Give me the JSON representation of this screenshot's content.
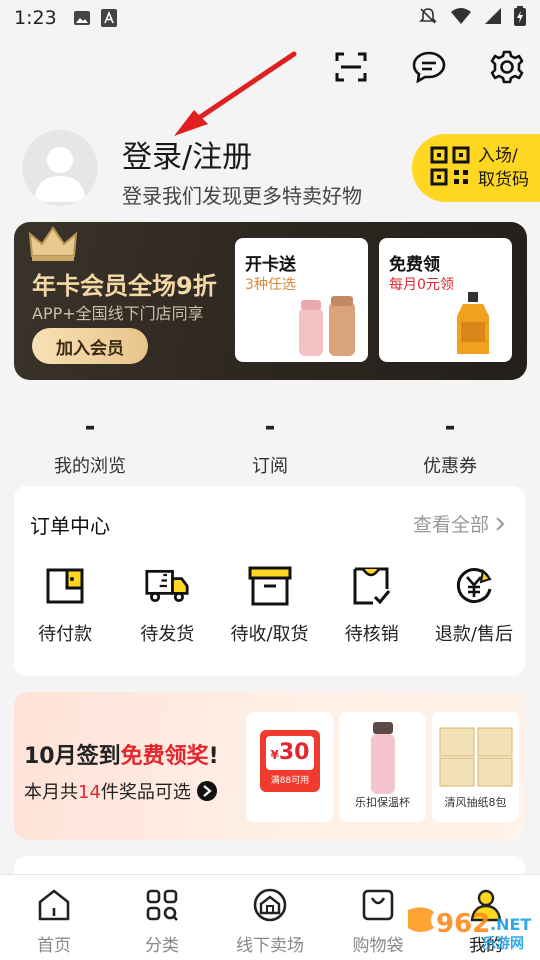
{
  "status_bar": {
    "time": "1:23"
  },
  "profile": {
    "title": "登录/注册",
    "subtitle": "登录我们发现更多特卖好物"
  },
  "entry_badge": {
    "line1": "入场/",
    "line2": "取货码"
  },
  "vip": {
    "title": "年卡会员全场9折",
    "subtitle": "APP+全国线下门店同享",
    "join_label": "加入会员",
    "box1": {
      "title": "开卡送",
      "sub": "3种任选"
    },
    "box2": {
      "title": "免费领",
      "sub": "每月0元领"
    }
  },
  "stats": [
    {
      "value": "-",
      "label": "我的浏览"
    },
    {
      "value": "-",
      "label": "订阅"
    },
    {
      "value": "-",
      "label": "优惠券"
    }
  ],
  "orders": {
    "title": "订单中心",
    "view_all": "查看全部",
    "items": [
      {
        "label": "待付款",
        "icon": "wallet-icon"
      },
      {
        "label": "待发货",
        "icon": "truck-icon"
      },
      {
        "label": "待收/取货",
        "icon": "box-icon"
      },
      {
        "label": "待核销",
        "icon": "check-icon"
      },
      {
        "label": "退款/售后",
        "icon": "refund-icon"
      }
    ]
  },
  "signin": {
    "title_black": "10月签到",
    "title_red": "免费领奖",
    "title_end": "!",
    "sub_pre": "本月共",
    "sub_num": "14",
    "sub_post": "件奖品可选",
    "coupon_value": "30",
    "coupon_currency": "¥",
    "coupon_cond": "满88可用",
    "prize2": "乐扣保温杯",
    "prize3": "清风抽纸8包"
  },
  "tabs": [
    {
      "label": "首页",
      "icon": "home-icon"
    },
    {
      "label": "分类",
      "icon": "category-icon"
    },
    {
      "label": "线下卖场",
      "icon": "store-icon"
    },
    {
      "label": "购物袋",
      "icon": "bag-icon"
    },
    {
      "label": "我的",
      "icon": "profile-icon"
    }
  ],
  "colors": {
    "accent": "#ffd620",
    "red": "#e3262d",
    "vip_bg": "#2c2620"
  }
}
